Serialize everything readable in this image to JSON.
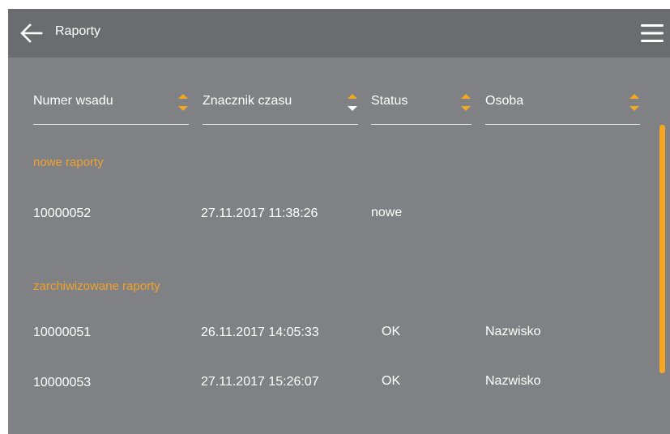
{
  "header": {
    "title": "Raporty",
    "back_icon": "arrow-left-icon",
    "menu_icon": "hamburger-menu-icon"
  },
  "columns": [
    {
      "label": "Numer wsadu",
      "sort": "none"
    },
    {
      "label": "Znacznik czasu",
      "sort": "descending"
    },
    {
      "label": "Status",
      "sort": "none"
    },
    {
      "label": "Osoba",
      "sort": "none"
    }
  ],
  "sections": {
    "new": {
      "title": "nowe raporty",
      "rows": [
        {
          "batch": "10000052",
          "timestamp": "27.11.2017 11:38:26",
          "status": "nowe",
          "person": ""
        }
      ]
    },
    "archived": {
      "title": "zarchiwizowane raporty",
      "rows": [
        {
          "batch": "10000051",
          "timestamp": "26.11.2017 14:05:33",
          "status": "OK",
          "person": "Nazwisko"
        },
        {
          "batch": "10000053",
          "timestamp": "27.11.2017 15:26:07",
          "status": "OK",
          "person": "Nazwisko"
        }
      ]
    }
  },
  "colors": {
    "background": "#808184",
    "appbar": "#6b6c6f",
    "accent": "#f5a623",
    "text": "#ffffff"
  }
}
